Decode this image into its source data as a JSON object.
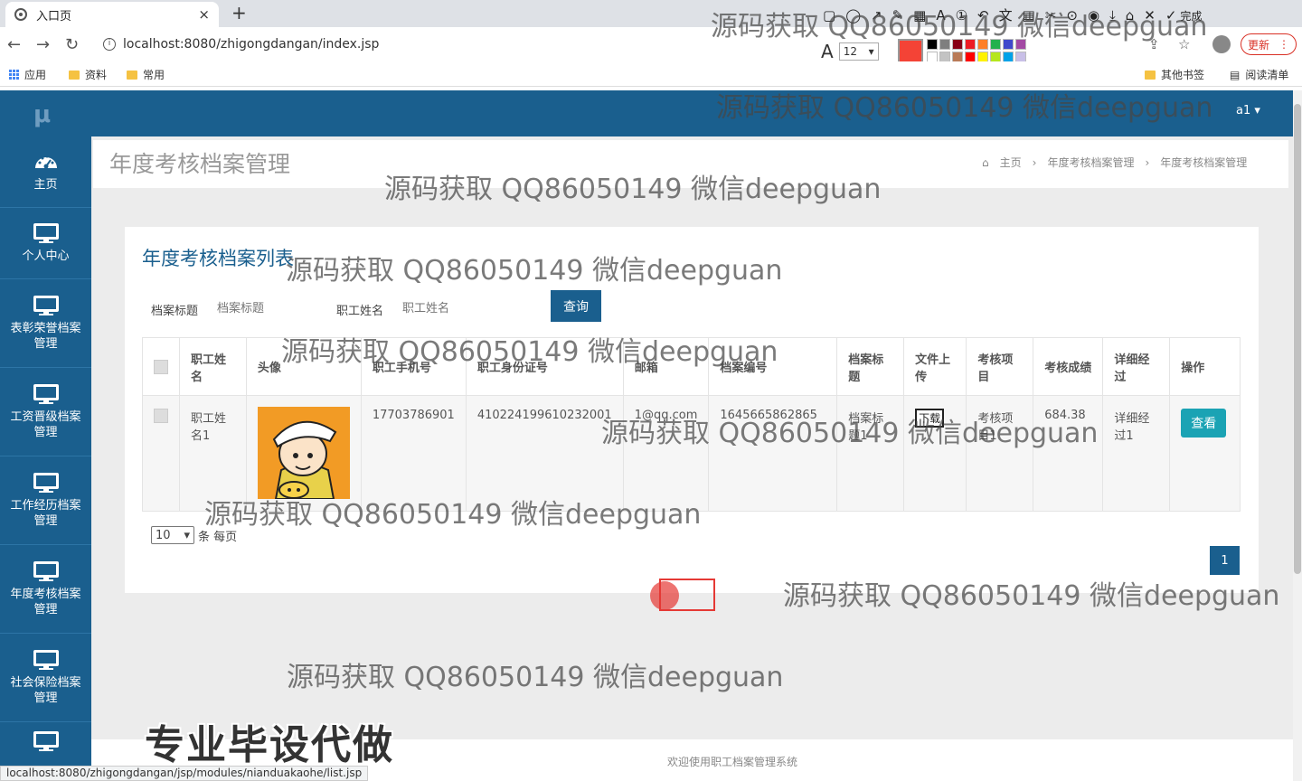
{
  "browser": {
    "tab_title": "入口页",
    "tab_close": "×",
    "new_tab": "+",
    "url": "localhost:8080/zhigongdangan/index.jsp",
    "font_size_value": "12",
    "done_label": "完成",
    "update_label": "更新",
    "status_url": "localhost:8080/zhigongdangan/jsp/modules/nianduakaohe/list.jsp",
    "palette": [
      "#000000",
      "#7f7f7f",
      "#880015",
      "#ed1c24",
      "#ff7f27",
      "#22b14c",
      "#3f48cc",
      "#a349a4",
      "#ffffff",
      "#c3c3c3",
      "#b97a57",
      "#ff0000",
      "#fff200",
      "#b5e61d",
      "#00a2e8",
      "#c8bfe7"
    ],
    "current_color": "#f44336",
    "bookmarks": {
      "apps": "应用",
      "item1": "资料",
      "item2": "常用",
      "other": "其他书签",
      "reading": "阅读清单"
    }
  },
  "app": {
    "logo": "μ",
    "user": "a1 ▾",
    "theme_color": "#1a5f8e",
    "sidebar": [
      {
        "label": "主页",
        "icon": "dashboard-icon"
      },
      {
        "label": "个人中心",
        "icon": "monitor-icon"
      },
      {
        "label": "表彰荣誉档案管理",
        "icon": "monitor-icon"
      },
      {
        "label": "工资晋级档案管理",
        "icon": "monitor-icon"
      },
      {
        "label": "工作经历档案管理",
        "icon": "monitor-icon"
      },
      {
        "label": "年度考核档案管理",
        "icon": "monitor-icon"
      },
      {
        "label": "社会保险档案管理",
        "icon": "monitor-icon"
      },
      {
        "label": "",
        "icon": "monitor-icon"
      }
    ],
    "page_title": "年度考核档案管理",
    "breadcrumb": [
      "主页",
      "年度考核档案管理",
      "年度考核档案管理"
    ],
    "card_title": "年度考核档案列表",
    "search": {
      "label1": "档案标题",
      "placeholder1": "档案标题",
      "label2": "职工姓名",
      "placeholder2": "职工姓名",
      "button": "查询"
    },
    "table": {
      "headers": [
        "职工姓名",
        "头像",
        "职工手机号",
        "职工身份证号",
        "邮箱",
        "档案编号",
        "档案标题",
        "文件上传",
        "考核项目",
        "考核成绩",
        "详细经过",
        "操作"
      ],
      "rows": [
        {
          "name": "职工姓名1",
          "phone": "17703786901",
          "id_card": "410224199610232001",
          "email": "1@qq.com",
          "file_no": "1645665862865",
          "title": "档案标题1",
          "upload": "下载",
          "project": "考核项目1",
          "score": "684.38",
          "detail": "详细经过1",
          "action": "查看"
        }
      ]
    },
    "page_size": "10",
    "page_size_suffix": "条 每页",
    "current_page": "1",
    "footer": "欢迎使用职工档案管理系统"
  },
  "overlay": {
    "watermark": "源码获取 QQ86050149 微信deepguan",
    "promo": "专业毕设代做"
  }
}
